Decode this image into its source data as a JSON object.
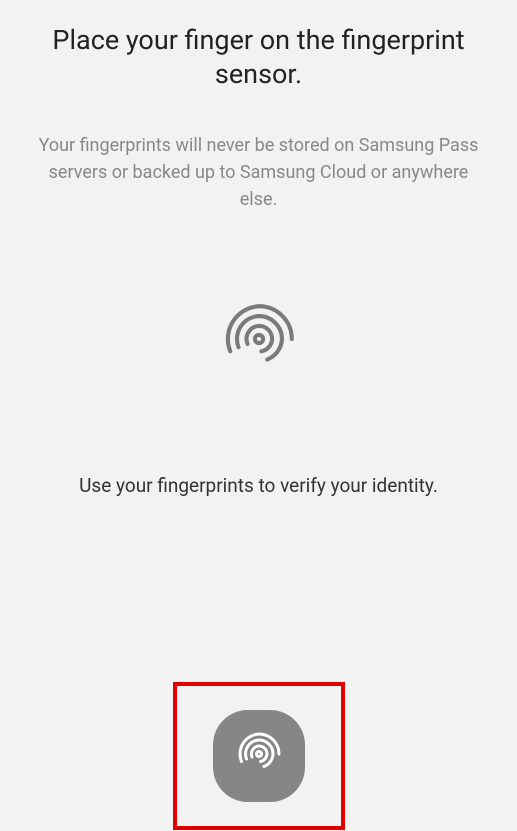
{
  "title": "Place your finger on the fingerprint sensor.",
  "subtitle": "Your fingerprints will never be stored on Samsung Pass servers or backed up to Samsung Cloud or anywhere else.",
  "instruction": "Use your fingerprints to verify your identity.",
  "icons": {
    "fingerprint_illustration": "fingerprint-icon",
    "fingerprint_sensor": "fingerprint-sensor-icon"
  }
}
